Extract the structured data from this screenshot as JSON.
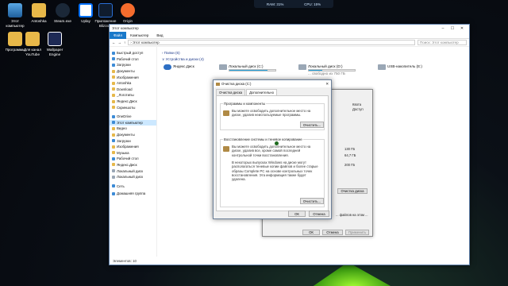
{
  "taskbar_stats": {
    "ram": "RAM: 31%",
    "cpu": "CPU: 15%"
  },
  "desktop_icons": [
    {
      "label": "Этот компьютер"
    },
    {
      "label": "Antoshka"
    },
    {
      "label": "Steam.exe"
    },
    {
      "label": "Uplay"
    },
    {
      "label": "Приложение Blizzard"
    },
    {
      "label": "Origin"
    },
    {
      "label": "Программы"
    },
    {
      "label": "Для канал YouTube"
    },
    {
      "label": "Wallpaper Engine"
    }
  ],
  "explorer": {
    "title": "Этот компьютер",
    "ribbon": {
      "file": "Файл",
      "computer": "Компьютер",
      "view": "Вид"
    },
    "address": "› Этот компьютер",
    "search_placeholder": "Поиск: Этот компьютер",
    "nav": [
      "Быстрый доступ",
      "Рабочий стол",
      "Загрузки",
      "Документы",
      "Изображения",
      "Antoshka",
      "Download",
      "_Логотипы",
      "Яндекс.Диск",
      "Скриншоты",
      "OneDrive",
      "Этот компьютер",
      "Видео",
      "Документы",
      "Загрузки",
      "Изображения",
      "Музыка",
      "Рабочий стол",
      "Яндекс.Диск",
      "Локальный диск",
      "Локальный диск",
      "Сеть",
      "Домашняя группа"
    ],
    "groups": {
      "folders": "› Папки (6)",
      "devices": "∨ Устройства и диски (4)"
    },
    "drives": [
      {
        "name": "Яндекс.Диск",
        "fill": 0,
        "free": ""
      },
      {
        "name": "Локальный диск (C:)",
        "fill": 0.82,
        "free": ""
      },
      {
        "name": "Локальный диск (D:)",
        "fill": 0.3,
        "free": "... свободно из 750 ГБ"
      },
      {
        "name": "USB-накопитель (E:)",
        "fill": 0,
        "free": ""
      }
    ],
    "status": "Элементов: 10"
  },
  "properties": {
    "col_headers": [
      "Квота",
      "Доступ"
    ],
    "sizes": [
      "130 ГБ",
      "64,7 ГБ",
      "200 ГБ"
    ],
    "cleanup_button": "Очистка диска",
    "footer_text": "... файлов на этом ...",
    "buttons": {
      "ok": "ОК",
      "cancel": "Отмена",
      "apply": "Применить"
    }
  },
  "cleanup": {
    "title": "Очистка диска (C:)",
    "tabs": [
      "Очистка диска",
      "Дополнительно"
    ],
    "programs": {
      "legend": "Программы и компоненты",
      "text": "Вы можете освободить дополнительное место на диске, удалив неиспользуемые программы.",
      "button": "Очистить..."
    },
    "restore": {
      "legend": "Восстановление системы и теневое копирование",
      "text1": "Вы можете освободить дополнительное место на диске, удалив все, кроме самой последней контрольной точки восстановления.",
      "text2": "В некоторых выпусках Windows на диске могут располагаться теневые копии файлов и более старые образы Complete PC на основе контрольных точек восстановления. Эта информация также будет удалена.",
      "button": "Очистить..."
    },
    "ok": "ОК",
    "cancel": "Отмена"
  }
}
